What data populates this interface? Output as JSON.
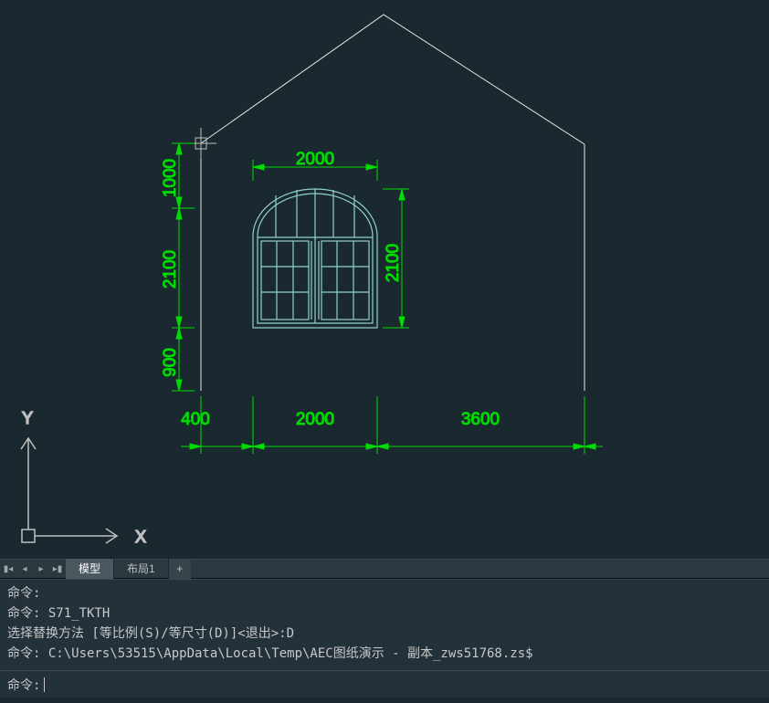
{
  "axes": {
    "x_label": "X",
    "y_label": "Y"
  },
  "dimensions": {
    "top_window_width": "2000",
    "left_top": "1000",
    "left_mid": "2100",
    "left_bottom": "900",
    "right_window_height": "2100",
    "bottom1": "400",
    "bottom2": "2000",
    "bottom3": "3600"
  },
  "tabs": {
    "model": "模型",
    "layout1": "布局1",
    "add": "+"
  },
  "command_history": {
    "line1": "命令:",
    "line2": "命令: S71_TKTH",
    "line3": "选择替换方法 [等比例(S)/等尺寸(D)]<退出>:D",
    "line4": "命令: C:\\Users\\53515\\AppData\\Local\\Temp\\AEC图纸演示 - 副本_zws51768.zs$"
  },
  "command_prompt": "命令:",
  "colors": {
    "drawing_line": "#e8e8e8",
    "dimension": "#00dc00",
    "background": "#1a2830",
    "panel": "#23313a"
  }
}
